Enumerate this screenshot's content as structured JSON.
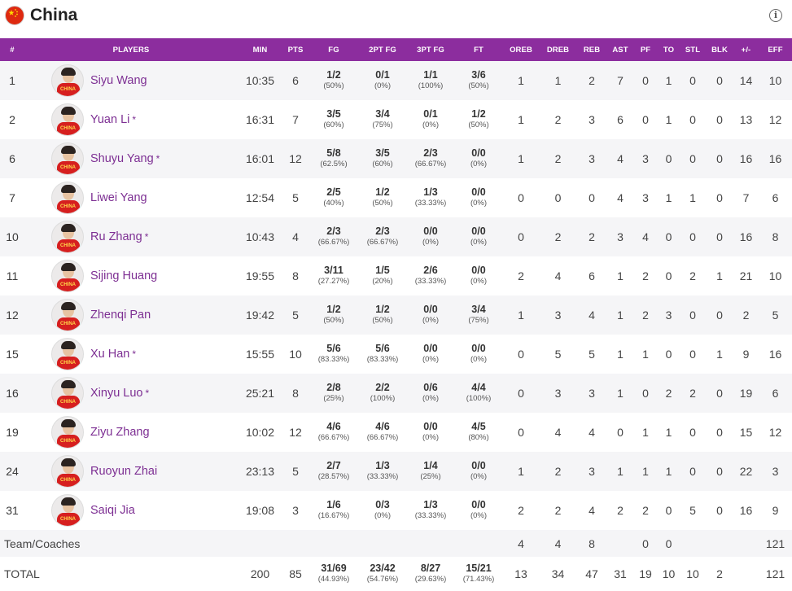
{
  "team": {
    "name": "China",
    "info_icon": "info-icon",
    "flag_colors": {
      "red": "#de2910",
      "yellow": "#ffde00"
    }
  },
  "accent": "#8c2d9e",
  "columns": [
    "#",
    "PLAYERS",
    "MIN",
    "PTS",
    "FG",
    "2PT FG",
    "3PT FG",
    "FT",
    "OREB",
    "DREB",
    "REB",
    "AST",
    "PF",
    "TO",
    "STL",
    "BLK",
    "+/-",
    "EFF"
  ],
  "players": [
    {
      "no": "1",
      "name": "Siyu Wang",
      "starter": false,
      "min": "10:35",
      "pts": "6",
      "fg": "1/2",
      "fg_pct": "(50%)",
      "fg2": "0/1",
      "fg2_pct": "(0%)",
      "fg3": "1/1",
      "fg3_pct": "(100%)",
      "ft": "3/6",
      "ft_pct": "(50%)",
      "oreb": "1",
      "dreb": "1",
      "reb": "2",
      "ast": "7",
      "pf": "0",
      "to": "1",
      "stl": "0",
      "blk": "0",
      "pm": "14",
      "eff": "10"
    },
    {
      "no": "2",
      "name": "Yuan Li",
      "starter": true,
      "min": "16:31",
      "pts": "7",
      "fg": "3/5",
      "fg_pct": "(60%)",
      "fg2": "3/4",
      "fg2_pct": "(75%)",
      "fg3": "0/1",
      "fg3_pct": "(0%)",
      "ft": "1/2",
      "ft_pct": "(50%)",
      "oreb": "1",
      "dreb": "2",
      "reb": "3",
      "ast": "6",
      "pf": "0",
      "to": "1",
      "stl": "0",
      "blk": "0",
      "pm": "13",
      "eff": "12"
    },
    {
      "no": "6",
      "name": "Shuyu Yang",
      "starter": true,
      "min": "16:01",
      "pts": "12",
      "fg": "5/8",
      "fg_pct": "(62.5%)",
      "fg2": "3/5",
      "fg2_pct": "(60%)",
      "fg3": "2/3",
      "fg3_pct": "(66.67%)",
      "ft": "0/0",
      "ft_pct": "(0%)",
      "oreb": "1",
      "dreb": "2",
      "reb": "3",
      "ast": "4",
      "pf": "3",
      "to": "0",
      "stl": "0",
      "blk": "0",
      "pm": "16",
      "eff": "16"
    },
    {
      "no": "7",
      "name": "Liwei Yang",
      "starter": false,
      "min": "12:54",
      "pts": "5",
      "fg": "2/5",
      "fg_pct": "(40%)",
      "fg2": "1/2",
      "fg2_pct": "(50%)",
      "fg3": "1/3",
      "fg3_pct": "(33.33%)",
      "ft": "0/0",
      "ft_pct": "(0%)",
      "oreb": "0",
      "dreb": "0",
      "reb": "0",
      "ast": "4",
      "pf": "3",
      "to": "1",
      "stl": "1",
      "blk": "0",
      "pm": "7",
      "eff": "6"
    },
    {
      "no": "10",
      "name": "Ru Zhang",
      "starter": true,
      "min": "10:43",
      "pts": "4",
      "fg": "2/3",
      "fg_pct": "(66.67%)",
      "fg2": "2/3",
      "fg2_pct": "(66.67%)",
      "fg3": "0/0",
      "fg3_pct": "(0%)",
      "ft": "0/0",
      "ft_pct": "(0%)",
      "oreb": "0",
      "dreb": "2",
      "reb": "2",
      "ast": "3",
      "pf": "4",
      "to": "0",
      "stl": "0",
      "blk": "0",
      "pm": "16",
      "eff": "8"
    },
    {
      "no": "11",
      "name": "Sijing Huang",
      "starter": false,
      "min": "19:55",
      "pts": "8",
      "fg": "3/11",
      "fg_pct": "(27.27%)",
      "fg2": "1/5",
      "fg2_pct": "(20%)",
      "fg3": "2/6",
      "fg3_pct": "(33.33%)",
      "ft": "0/0",
      "ft_pct": "(0%)",
      "oreb": "2",
      "dreb": "4",
      "reb": "6",
      "ast": "1",
      "pf": "2",
      "to": "0",
      "stl": "2",
      "blk": "1",
      "pm": "21",
      "eff": "10"
    },
    {
      "no": "12",
      "name": "Zhenqi Pan",
      "starter": false,
      "min": "19:42",
      "pts": "5",
      "fg": "1/2",
      "fg_pct": "(50%)",
      "fg2": "1/2",
      "fg2_pct": "(50%)",
      "fg3": "0/0",
      "fg3_pct": "(0%)",
      "ft": "3/4",
      "ft_pct": "(75%)",
      "oreb": "1",
      "dreb": "3",
      "reb": "4",
      "ast": "1",
      "pf": "2",
      "to": "3",
      "stl": "0",
      "blk": "0",
      "pm": "2",
      "eff": "5"
    },
    {
      "no": "15",
      "name": "Xu Han",
      "starter": true,
      "min": "15:55",
      "pts": "10",
      "fg": "5/6",
      "fg_pct": "(83.33%)",
      "fg2": "5/6",
      "fg2_pct": "(83.33%)",
      "fg3": "0/0",
      "fg3_pct": "(0%)",
      "ft": "0/0",
      "ft_pct": "(0%)",
      "oreb": "0",
      "dreb": "5",
      "reb": "5",
      "ast": "1",
      "pf": "1",
      "to": "0",
      "stl": "0",
      "blk": "1",
      "pm": "9",
      "eff": "16"
    },
    {
      "no": "16",
      "name": "Xinyu Luo",
      "starter": true,
      "min": "25:21",
      "pts": "8",
      "fg": "2/8",
      "fg_pct": "(25%)",
      "fg2": "2/2",
      "fg2_pct": "(100%)",
      "fg3": "0/6",
      "fg3_pct": "(0%)",
      "ft": "4/4",
      "ft_pct": "(100%)",
      "oreb": "0",
      "dreb": "3",
      "reb": "3",
      "ast": "1",
      "pf": "0",
      "to": "2",
      "stl": "2",
      "blk": "0",
      "pm": "19",
      "eff": "6"
    },
    {
      "no": "19",
      "name": "Ziyu Zhang",
      "starter": false,
      "min": "10:02",
      "pts": "12",
      "fg": "4/6",
      "fg_pct": "(66.67%)",
      "fg2": "4/6",
      "fg2_pct": "(66.67%)",
      "fg3": "0/0",
      "fg3_pct": "(0%)",
      "ft": "4/5",
      "ft_pct": "(80%)",
      "oreb": "0",
      "dreb": "4",
      "reb": "4",
      "ast": "0",
      "pf": "1",
      "to": "1",
      "stl": "0",
      "blk": "0",
      "pm": "15",
      "eff": "12"
    },
    {
      "no": "24",
      "name": "Ruoyun Zhai",
      "starter": false,
      "min": "23:13",
      "pts": "5",
      "fg": "2/7",
      "fg_pct": "(28.57%)",
      "fg2": "1/3",
      "fg2_pct": "(33.33%)",
      "fg3": "1/4",
      "fg3_pct": "(25%)",
      "ft": "0/0",
      "ft_pct": "(0%)",
      "oreb": "1",
      "dreb": "2",
      "reb": "3",
      "ast": "1",
      "pf": "1",
      "to": "1",
      "stl": "0",
      "blk": "0",
      "pm": "22",
      "eff": "3"
    },
    {
      "no": "31",
      "name": "Saiqi Jia",
      "starter": false,
      "min": "19:08",
      "pts": "3",
      "fg": "1/6",
      "fg_pct": "(16.67%)",
      "fg2": "0/3",
      "fg2_pct": "(0%)",
      "fg3": "1/3",
      "fg3_pct": "(33.33%)",
      "ft": "0/0",
      "ft_pct": "(0%)",
      "oreb": "2",
      "dreb": "2",
      "reb": "4",
      "ast": "2",
      "pf": "2",
      "to": "0",
      "stl": "5",
      "blk": "0",
      "pm": "16",
      "eff": "9"
    }
  ],
  "team_coaches": {
    "label": "Team/Coaches",
    "oreb": "4",
    "dreb": "4",
    "reb": "8",
    "ast": "",
    "pf": "0",
    "to": "0",
    "stl": "",
    "blk": "",
    "pm": "",
    "eff": "121"
  },
  "total": {
    "label": "TOTAL",
    "min": "200",
    "pts": "85",
    "fg": "31/69",
    "fg_pct": "(44.93%)",
    "fg2": "23/42",
    "fg2_pct": "(54.76%)",
    "fg3": "8/27",
    "fg3_pct": "(29.63%)",
    "ft": "15/21",
    "ft_pct": "(71.43%)",
    "oreb": "13",
    "dreb": "34",
    "reb": "47",
    "ast": "31",
    "pf": "19",
    "to": "10",
    "stl": "10",
    "blk": "2",
    "pm": "",
    "eff": "121"
  },
  "jersey_text": "CHINA",
  "starter_mark": "*"
}
